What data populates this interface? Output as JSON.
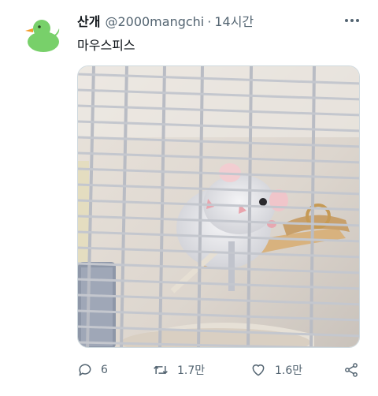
{
  "user": {
    "display_name": "산개",
    "handle": "@2000mangchi",
    "time": "14시간",
    "avatar_icon": "rubber-duck-icon"
  },
  "tweet": {
    "text": "마우스피스"
  },
  "media": {
    "icon": "photo-white-mouse-in-cage"
  },
  "actions": {
    "reply_count": "6",
    "retweet_count": "1.7만",
    "like_count": "1.6만"
  },
  "colors": {
    "text_primary": "#0f1419",
    "text_secondary": "#536471",
    "border": "#cfd9de",
    "avatar_bg": "#6fcf63"
  }
}
